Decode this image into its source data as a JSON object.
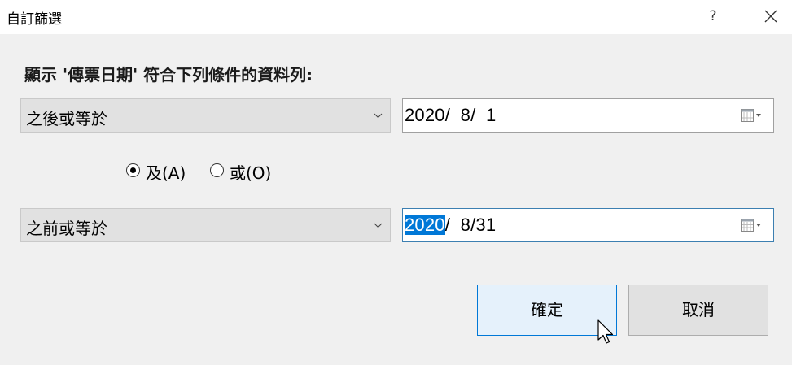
{
  "window": {
    "title": "自訂篩選",
    "help_label": "?"
  },
  "prompt": "顯示 '傳票日期' 符合下列條件的資料列:",
  "condition1": {
    "operator": "之後或等於",
    "date": "2020/  8/  1"
  },
  "logic": {
    "and_label": "及(A)",
    "or_label": "或(O)",
    "selected": "and"
  },
  "condition2": {
    "operator": "之前或等於",
    "date_selected": "2020",
    "date_rest": "/  8/31"
  },
  "buttons": {
    "ok": "確定",
    "cancel": "取消"
  },
  "icons": {
    "close": "close-icon",
    "dropdown": "chevron-down-icon",
    "calendar": "calendar-icon",
    "cursor": "mouse-pointer-icon"
  },
  "colors": {
    "accent": "#0078d7",
    "dialog_bg": "#f0f0f0"
  }
}
